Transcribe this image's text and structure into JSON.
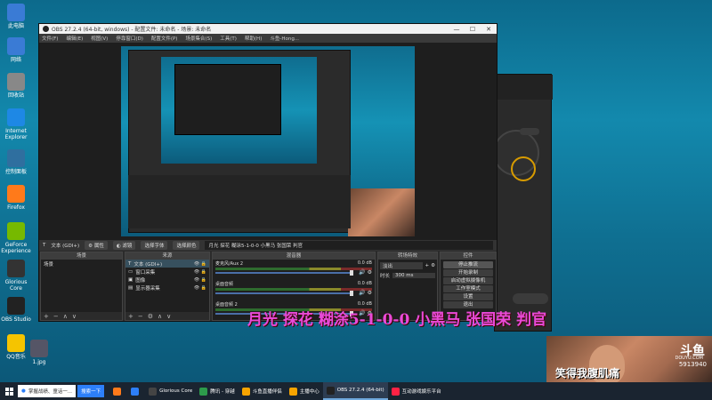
{
  "desktop": {
    "icons": [
      {
        "label": "此电脑",
        "color": "#3a7bd5"
      },
      {
        "label": "网络",
        "color": "#3a7bd5"
      },
      {
        "label": "回收站",
        "color": "#888"
      },
      {
        "label": "Internet Explorer",
        "color": "#1e88e5"
      },
      {
        "label": "控制面板",
        "color": "#2f6f9f"
      },
      {
        "label": "Firefox",
        "color": "#ff7a1a"
      },
      {
        "label": "GeForce Experience",
        "color": "#76b900"
      },
      {
        "label": "Glorious Core",
        "color": "#333"
      },
      {
        "label": "OBS Studio",
        "color": "#222"
      },
      {
        "label": "QQ音乐",
        "color": "#f5c400"
      },
      {
        "label": "1.jpg",
        "color": "#556"
      }
    ]
  },
  "obs": {
    "title": "OBS 27.2.4 (64-bit, windows) - 配置文件: 未命名 - 场景: 未命名",
    "menu": [
      "文件(F)",
      "编辑(E)",
      "视图(V)",
      "停靠窗口(D)",
      "配置文件(P)",
      "场景集合(S)",
      "工具(T)",
      "帮助(H)",
      "斗鱼-Hong..."
    ],
    "source_bar": {
      "selected": "文本 (GDI+)",
      "props": "属性",
      "filters": "滤镜",
      "select_file": "选择字体",
      "select_color": "选择颜色",
      "text": "月光  探花  糊涂5-1-0-0  小黑马  张国荣  判官"
    },
    "docks": {
      "scenes": {
        "title": "场景",
        "items": [
          "场景"
        ]
      },
      "sources": {
        "title": "来源",
        "items": [
          "文本 (GDI+)",
          "窗口采集",
          "图像",
          "显示器采集"
        ]
      },
      "mixer": {
        "title": "混音器",
        "channels": [
          {
            "name": "麦克风/Aux 2",
            "db": "0.0 dB"
          },
          {
            "name": "桌面音频",
            "db": "0.0 dB"
          },
          {
            "name": "桌面音频 2",
            "db": "0.0 dB"
          }
        ]
      },
      "transitions": {
        "title": "转场特效",
        "type": "淡出",
        "duration_label": "时长",
        "duration": "300 ms"
      },
      "controls": {
        "title": "控件",
        "buttons": [
          "停止推流",
          "开始录制",
          "启动虚拟摄像机",
          "工作室模式",
          "设置",
          "退出"
        ]
      }
    }
  },
  "overlay": {
    "caption": "月光  探花  糊涂5-1-0-0  小黑马  张国荣  判官",
    "cam_logo": "斗鱼",
    "cam_logo_sub": "DOUYU.COM",
    "cam_text": "笑得我腹肌痛",
    "cam_id": "5913940"
  },
  "taskbar": {
    "search_text": "掌握战绩、童话一...",
    "search_btn": "搜索一下",
    "items": [
      {
        "label": "",
        "color": "#ff7a1a"
      },
      {
        "label": "",
        "color": "#2d7ff9"
      },
      {
        "label": "Glorious Core",
        "color": "#444"
      },
      {
        "label": "腾讯 - 穿越",
        "color": "#2d9b4b"
      },
      {
        "label": "斗鱼直播伴侣",
        "color": "#f7a400"
      },
      {
        "label": "主播中心",
        "color": "#f7a400"
      },
      {
        "label": "OBS 27.2.4 (64-bit)",
        "color": "#222"
      },
      {
        "label": "互动游戏娱乐平台",
        "color": "#f24"
      }
    ]
  }
}
